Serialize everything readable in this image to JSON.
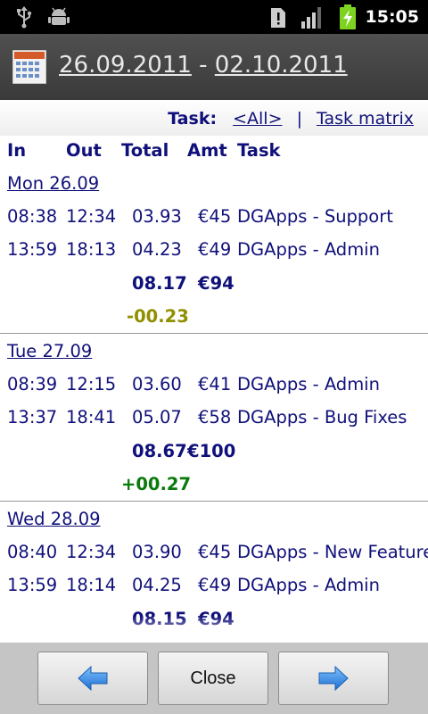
{
  "status": {
    "time": "15:05"
  },
  "header": {
    "start_date": "26.09.2011",
    "separator": " - ",
    "end_date": "02.10.2011"
  },
  "filter": {
    "label": "Task:",
    "all_link": "<All>",
    "divider": "|",
    "matrix_link": "Task matrix"
  },
  "columns": {
    "in": "In",
    "out": "Out",
    "total": "Total",
    "amt": "Amt",
    "task": "Task"
  },
  "days": [
    {
      "label": "Mon 26.09",
      "entries": [
        {
          "in": "08:38",
          "out": "12:34",
          "total": "03.93",
          "amt": "€45",
          "task": "DGApps - Support"
        },
        {
          "in": "13:59",
          "out": "18:13",
          "total": "04.23",
          "amt": "€49",
          "task": "DGApps - Admin"
        }
      ],
      "sum_total": "08.17",
      "sum_amt": "€94",
      "diff": "-00.23"
    },
    {
      "label": "Tue 27.09",
      "entries": [
        {
          "in": "08:39",
          "out": "12:15",
          "total": "03.60",
          "amt": "€41",
          "task": "DGApps - Admin"
        },
        {
          "in": "13:37",
          "out": "18:41",
          "total": "05.07",
          "amt": "€58",
          "task": "DGApps - Bug Fixes"
        }
      ],
      "sum_total": "08.67",
      "sum_amt": "€100",
      "diff": "+00.27"
    },
    {
      "label": "Wed 28.09",
      "entries": [
        {
          "in": "08:40",
          "out": "12:34",
          "total": "03.90",
          "amt": "€45",
          "task": "DGApps - New Features"
        },
        {
          "in": "13:59",
          "out": "18:14",
          "total": "04.25",
          "amt": "€49",
          "task": "DGApps - Admin"
        }
      ],
      "sum_total": "08.15",
      "sum_amt": "€94"
    }
  ],
  "buttons": {
    "prev_icon": "arrow-left-icon",
    "close": "Close",
    "next_icon": "arrow-right-icon"
  },
  "colors": {
    "text": "#10107a",
    "negative": "#8f8f00",
    "positive": "#0a7a0a",
    "arrow": "#2e8be0"
  }
}
